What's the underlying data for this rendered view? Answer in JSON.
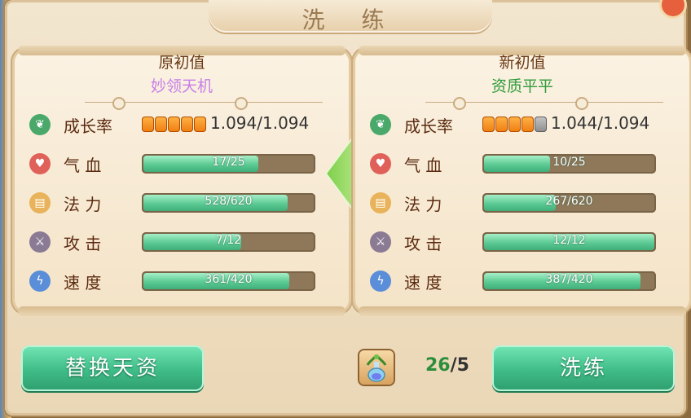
{
  "dialog": {
    "title": "洗 练"
  },
  "left_panel": {
    "header": "原初值",
    "quality": "妙领天机",
    "quality_color": "#c77ee8",
    "growth": {
      "label": "成长率",
      "pips_on": 5,
      "pips_total": 5,
      "value": "1.094/1.094"
    },
    "stats": [
      {
        "label": "气 血",
        "value": "17/25",
        "ratio": 0.68,
        "icon": "heart-icon"
      },
      {
        "label": "法 力",
        "value": "528/620",
        "ratio": 0.85,
        "icon": "scroll-icon"
      },
      {
        "label": "攻 击",
        "value": "7/12",
        "ratio": 0.58,
        "icon": "sword-icon"
      },
      {
        "label": "速 度",
        "value": "361/420",
        "ratio": 0.86,
        "icon": "lightning-icon"
      }
    ]
  },
  "right_panel": {
    "header": "新初值",
    "quality": "资质平平",
    "quality_color": "#2f9b3a",
    "growth": {
      "label": "成长率",
      "pips_on": 4,
      "pips_total": 5,
      "value": "1.044/1.094"
    },
    "stats": [
      {
        "label": "气 血",
        "value": "10/25",
        "ratio": 0.4,
        "icon": "heart-icon"
      },
      {
        "label": "法 力",
        "value": "267/620",
        "ratio": 0.43,
        "icon": "scroll-icon"
      },
      {
        "label": "攻 击",
        "value": "12/12",
        "ratio": 1.0,
        "icon": "sword-icon"
      },
      {
        "label": "速 度",
        "value": "387/420",
        "ratio": 0.92,
        "icon": "lightning-icon"
      }
    ]
  },
  "actions": {
    "replace_label": "替换天资",
    "refine_label": "洗练",
    "item_count_current": "26",
    "item_count_separator": "/",
    "item_count_required": "5",
    "item_icon": "potion-bottle-icon"
  },
  "colors": {
    "button": "#3fbc88",
    "growth_icon": "#4aa86a",
    "heart_icon": "#e0605a",
    "scroll_icon": "#e8b35a",
    "sword_icon": "#8a7a94",
    "lightning_icon": "#5a8ed8"
  }
}
